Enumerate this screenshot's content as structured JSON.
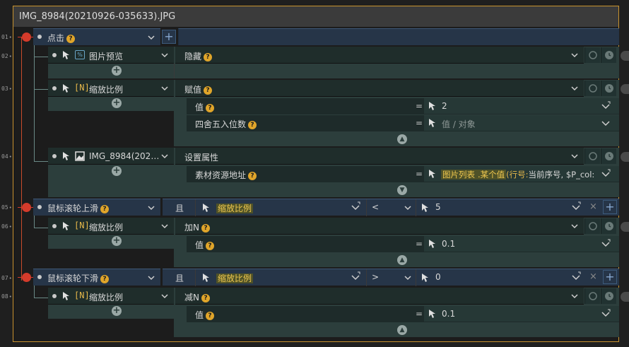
{
  "window": {
    "title": "IMG_8984(20210926-035633).JPG"
  },
  "line_numbers": [
    "01",
    "02",
    "03",
    "04",
    "05",
    "06",
    "07",
    "08"
  ],
  "events": {
    "click": {
      "label": "点击"
    },
    "wheel_up": {
      "label": "鼠标滚轮上滑",
      "conj": "且",
      "var": "缩放比例",
      "op": "<",
      "value": "5"
    },
    "wheel_down": {
      "label": "鼠标滚轮下滑",
      "conj": "且",
      "var": "缩放比例",
      "op": ">",
      "value": "0"
    }
  },
  "actions": {
    "a02": {
      "target": "图片预览",
      "action": "隐藏"
    },
    "a03": {
      "target": "缩放比例",
      "badge": "[N]",
      "action": "赋值",
      "params": [
        {
          "label": "值",
          "value": "2"
        },
        {
          "label": "四舍五入位数",
          "placeholder": "值 / 对象"
        }
      ]
    },
    "a04": {
      "target": "IMG_8984(202…",
      "action": "设置属性",
      "params": [
        {
          "label": "素材资源地址",
          "hl1": "图片列表",
          "hl2": ".某个值",
          "rest1": "(行号:",
          "rest2": "当前序号",
          "rest3": ", $P_col:"
        }
      ]
    },
    "a06": {
      "target": "缩放比例",
      "badge": "[N]",
      "action": "加N",
      "params": [
        {
          "label": "值",
          "value": "0.1"
        }
      ]
    },
    "a08": {
      "target": "缩放比例",
      "badge": "[N]",
      "action": "减N",
      "params": [
        {
          "label": "值",
          "value": "0.1"
        }
      ]
    }
  },
  "symbols": {
    "eq": "=",
    "q": "?"
  },
  "colors": {
    "accent_border": "#c8922e",
    "event_bar": "#263548",
    "block": "#2c3e3c",
    "help_badge": "#e0a52a",
    "trigger_line": "#d43b2b"
  }
}
